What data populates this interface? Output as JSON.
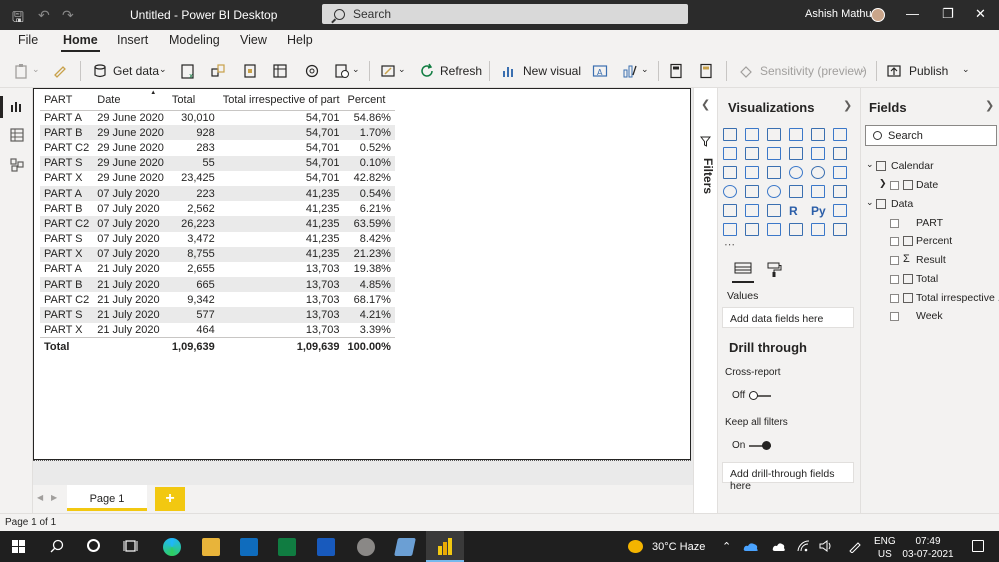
{
  "window": {
    "title": "Untitled - Power BI Desktop",
    "search_label": "Search",
    "user_name": "Ashish Mathur"
  },
  "menu": {
    "items": [
      "File",
      "Home",
      "Insert",
      "Modeling",
      "View",
      "Help"
    ],
    "active": "Home"
  },
  "ribbon": {
    "get_data": "Get data",
    "refresh": "Refresh",
    "new_visual": "New visual",
    "sensitivity": "Sensitivity (preview)",
    "publish": "Publish"
  },
  "table": {
    "headers": [
      "PART",
      "Date",
      "Total",
      "Total irrespective of part",
      "Percent"
    ],
    "rows": [
      [
        "PART A",
        "29 June 2020",
        "30,010",
        "54,701",
        "54.86%"
      ],
      [
        "PART B",
        "29 June 2020",
        "928",
        "54,701",
        "1.70%"
      ],
      [
        "PART C2",
        "29 June 2020",
        "283",
        "54,701",
        "0.52%"
      ],
      [
        "PART S",
        "29 June 2020",
        "55",
        "54,701",
        "0.10%"
      ],
      [
        "PART X",
        "29 June 2020",
        "23,425",
        "54,701",
        "42.82%"
      ],
      [
        "PART A",
        "07 July 2020",
        "223",
        "41,235",
        "0.54%"
      ],
      [
        "PART B",
        "07 July 2020",
        "2,562",
        "41,235",
        "6.21%"
      ],
      [
        "PART C2",
        "07 July 2020",
        "26,223",
        "41,235",
        "63.59%"
      ],
      [
        "PART S",
        "07 July 2020",
        "3,472",
        "41,235",
        "8.42%"
      ],
      [
        "PART X",
        "07 July 2020",
        "8,755",
        "41,235",
        "21.23%"
      ],
      [
        "PART A",
        "21 July 2020",
        "2,655",
        "13,703",
        "19.38%"
      ],
      [
        "PART B",
        "21 July 2020",
        "665",
        "13,703",
        "4.85%"
      ],
      [
        "PART C2",
        "21 July 2020",
        "9,342",
        "13,703",
        "68.17%"
      ],
      [
        "PART S",
        "21 July 2020",
        "577",
        "13,703",
        "4.21%"
      ],
      [
        "PART X",
        "21 July 2020",
        "464",
        "13,703",
        "3.39%"
      ]
    ],
    "totals": {
      "label": "Total",
      "total": "1,09,639",
      "total_irrespective": "1,09,639",
      "percent": "100.00%"
    }
  },
  "pages": {
    "tab": "Page 1",
    "add": "+",
    "status": "Page 1 of 1"
  },
  "filters": {
    "label": "Filters"
  },
  "visualizations": {
    "title": "Visualizations",
    "values_label": "Values",
    "values_well": "Add data fields here",
    "drill_title": "Drill through",
    "cross_report": "Cross-report",
    "cross_report_state": "Off",
    "keep_filters": "Keep all filters",
    "keep_filters_state": "On",
    "drill_well": "Add drill-through fields here",
    "r_icon": "R",
    "py_icon": "Py"
  },
  "fields": {
    "title": "Fields",
    "search_placeholder": "Search",
    "tables": [
      {
        "name": "Calendar",
        "fields": [
          "Date"
        ]
      },
      {
        "name": "Data",
        "fields": [
          "PART",
          "Percent",
          "Result",
          "Total",
          "Total irrespective ...",
          "Week"
        ]
      }
    ]
  },
  "taskbar": {
    "weather": "30°C  Haze",
    "lang_1": "ENG",
    "lang_2": "US",
    "time": "07:49",
    "date": "03-07-2021"
  },
  "colors": {
    "accent_yellow": "#f2c811",
    "titlebar": "#2b2b2b",
    "pane_bg": "#f3f2f1",
    "viz_blue": "#3a6fb0"
  }
}
